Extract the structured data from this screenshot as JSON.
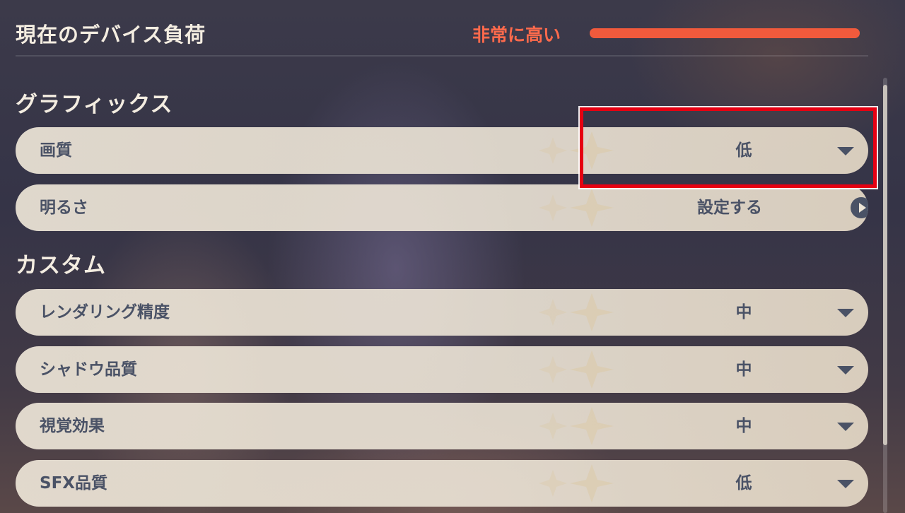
{
  "header": {
    "title": "現在のデバイス負荷",
    "load_label": "非常に高い",
    "load_level_percent": 100,
    "load_color": "#f15a3c"
  },
  "sections": {
    "graphics": {
      "title": "グラフィックス",
      "quality": {
        "label": "画質",
        "value": "低"
      },
      "brightness": {
        "label": "明るさ",
        "value": "設定する"
      }
    },
    "custom": {
      "title": "カスタム",
      "render_resolution": {
        "label": "レンダリング精度",
        "value": "中"
      },
      "shadow_quality": {
        "label": "シャドウ品質",
        "value": "中"
      },
      "visual_effects": {
        "label": "視覚効果",
        "value": "中"
      },
      "sfx_quality": {
        "label": "SFX品質",
        "value": "低"
      }
    }
  },
  "annotation": {
    "highlight_color": "#e60012"
  },
  "icons": {
    "dropdown": "chevron-down-icon",
    "navigate": "arrow-right-circle-icon",
    "decoration": "sparkle-icon"
  }
}
